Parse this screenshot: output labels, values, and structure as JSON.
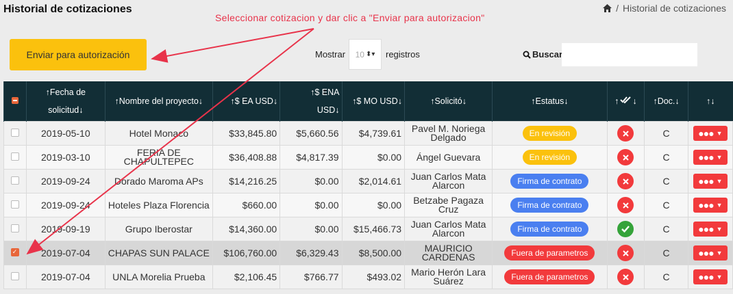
{
  "page": {
    "title": "Historial de cotizaciones",
    "breadcrumb": {
      "separator": "/",
      "current": "Historial de cotizaciones"
    },
    "annotation": "Seleccionar cotizacion y dar clic a \"Enviar para autorizacion\""
  },
  "toolbar": {
    "send_label": "Enviar para autorización",
    "show_label": "Mostrar",
    "page_size": "10",
    "records_label": "registros",
    "search_label": "Buscar:",
    "search_value": ""
  },
  "colors": {
    "header_bg": "#122e36",
    "send_button": "#fbc10d",
    "badge_revision": "#fbc10d",
    "badge_firma": "#4a7ff0",
    "badge_fuera": "#f23a3c",
    "status_x": "#f23a3c",
    "status_ok": "#35a33a",
    "annotation": "#e8334a",
    "checkbox_checked": "#e8663a"
  },
  "table": {
    "headers": [
      {
        "key": "fecha",
        "line1": "↑Fecha de",
        "line2": "solicitud↓"
      },
      {
        "key": "proyecto",
        "line1": "↑Nombre del proyecto↓",
        "line2": ""
      },
      {
        "key": "ea",
        "line1": "↑$ EA USD↓",
        "line2": ""
      },
      {
        "key": "ena",
        "line1": "↑$ ENA",
        "line2": "USD↓"
      },
      {
        "key": "mo",
        "line1": "↑$ MO USD↓",
        "line2": ""
      },
      {
        "key": "solicito",
        "line1": "↑Solicitó↓",
        "line2": ""
      },
      {
        "key": "estatus",
        "line1": "↑Estatus↓",
        "line2": ""
      },
      {
        "key": "auth",
        "line1": "↑",
        "line2": "↓",
        "icon": "double-check-icon"
      },
      {
        "key": "doc",
        "line1": "↑Doc.↓",
        "line2": ""
      },
      {
        "key": "acciones",
        "line1": "↑↓",
        "line2": ""
      }
    ],
    "rows": [
      {
        "checked": false,
        "fecha": "2019-05-10",
        "proyecto": "Hotel Monaco",
        "ea": "$33,845.80",
        "ena": "$5,660.56",
        "mo": "$4,739.61",
        "solicito": "Pavel M. Noriega Delgado",
        "estatus": "En revisión",
        "estatus_type": "revision",
        "auth": "x-icon",
        "doc": "C"
      },
      {
        "checked": false,
        "fecha": "2019-03-10",
        "proyecto": "FERIA DE CHAPULTEPEC",
        "ea": "$36,408.88",
        "ena": "$4,817.39",
        "mo": "$0.00",
        "solicito": "Ángel Guevara",
        "estatus": "En revisión",
        "estatus_type": "revision",
        "auth": "x-icon",
        "doc": "C"
      },
      {
        "checked": false,
        "fecha": "2019-09-24",
        "proyecto": "Dorado Maroma APs",
        "ea": "$14,216.25",
        "ena": "$0.00",
        "mo": "$2,014.61",
        "solicito": "Juan Carlos Mata Alarcon",
        "estatus": "Firma de contrato",
        "estatus_type": "firma",
        "auth": "x-icon",
        "doc": "C"
      },
      {
        "checked": false,
        "fecha": "2019-09-24",
        "proyecto": "Hoteles Plaza Florencia",
        "ea": "$660.00",
        "ena": "$0.00",
        "mo": "$0.00",
        "solicito": "Betzabe Pagaza Cruz",
        "estatus": "Firma de contrato",
        "estatus_type": "firma",
        "auth": "x-icon",
        "doc": "C"
      },
      {
        "checked": false,
        "fecha": "2019-09-19",
        "proyecto": "Grupo Iberostar",
        "ea": "$14,360.00",
        "ena": "$0.00",
        "mo": "$15,466.73",
        "solicito": "Juan Carlos Mata Alarcon",
        "estatus": "Firma de contrato",
        "estatus_type": "firma",
        "auth": "check-icon",
        "doc": "C"
      },
      {
        "checked": true,
        "fecha": "2019-07-04",
        "proyecto": "CHAPAS SUN PALACE",
        "ea": "$106,760.00",
        "ena": "$6,329.43",
        "mo": "$8,500.00",
        "solicito": "MAURICIO CARDENAS",
        "estatus": "Fuera de parametros",
        "estatus_type": "fuera",
        "auth": "x-icon",
        "doc": "C"
      },
      {
        "checked": false,
        "fecha": "2019-07-04",
        "proyecto": "UNLA Morelia Prueba",
        "ea": "$2,106.45",
        "ena": "$766.77",
        "mo": "$493.02",
        "solicito": "Mario Herón Lara Suárez",
        "estatus": "Fuera de parametros",
        "estatus_type": "fuera",
        "auth": "x-icon",
        "doc": "C"
      }
    ]
  }
}
